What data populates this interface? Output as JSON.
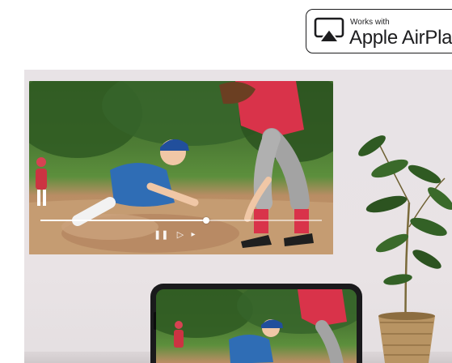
{
  "badge": {
    "small_text": "Works with",
    "big_text": "Apple AirPlay",
    "icon": "airplay-icon",
    "border_color": "#1d1d1f"
  },
  "video": {
    "progress_fraction": 0.59,
    "controls": {
      "pause_icon": "pause-icon",
      "pause_glyph": "❚❚",
      "play_icon": "play-icon",
      "play_glyph": "▷",
      "more_icon": "more-icon",
      "more_glyph": "▸"
    }
  },
  "colors": {
    "wall": "#e8e3e6",
    "field_grass": "#4e7d35",
    "field_dirt": "#c49a70",
    "jersey_blue": "#2f6db5",
    "jersey_red": "#d9334a"
  }
}
